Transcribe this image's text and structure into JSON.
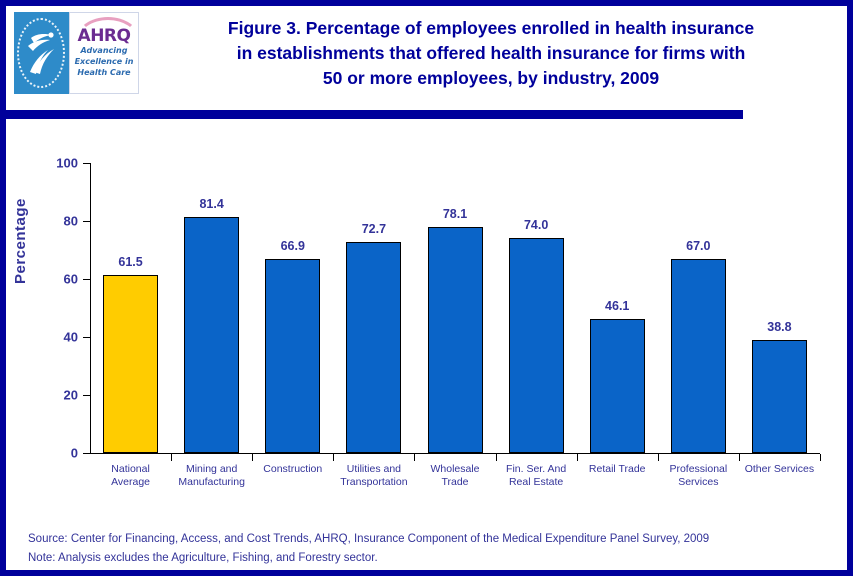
{
  "header": {
    "title": "Figure 3. Percentage of employees enrolled in health insurance in establishments that offered health insurance for firms with 50 or more employees, by industry, 2009",
    "title_line1": "Figure 3. Percentage of employees enrolled in health insurance",
    "title_line2": "in establishments that offered health insurance for firms with",
    "title_line3": "50 or more employees, by industry, 2009",
    "logo": {
      "seal_name": "hhs-department-seal",
      "agency_acronym": "AHRQ",
      "tagline_line1": "Advancing",
      "tagline_line2": "Excellence in",
      "tagline_line3": "Health Care"
    }
  },
  "footnotes": {
    "source": "Source: Center for Financing, Access, and Cost Trends, AHRQ, Insurance Component of the Medical Expenditure Panel Survey, 2009",
    "note": "Note: Analysis excludes the Agriculture, Fishing, and Forestry sector."
  },
  "colors": {
    "frame": "#00009B",
    "title": "#00009B",
    "rule": "#00009B",
    "bar_default": "#0A64C8",
    "bar_highlight": "#FFCC00",
    "bar_outline": "#000000",
    "label_text": "#333399",
    "footnote_text": "#333399"
  },
  "chart_data": {
    "type": "bar",
    "title": "Figure 3. Percentage of employees enrolled in health insurance in establishments that offered health insurance for firms with 50 or more employees, by industry, 2009",
    "xlabel": "",
    "ylabel": "Percentage",
    "ylim": [
      0,
      100
    ],
    "yticks": [
      0,
      20,
      40,
      60,
      80,
      100
    ],
    "ytick_labels": [
      "0",
      "20",
      "40",
      "60",
      "80",
      "100"
    ],
    "grid": false,
    "legend": null,
    "categories": [
      "National Average",
      "Mining and Manufacturing",
      "Construction",
      "Utilities and Transportation",
      "Wholesale Trade",
      "Fin. Ser. And Real Estate",
      "Retail Trade",
      "Professional Services",
      "Other Services"
    ],
    "category_lines": [
      [
        "National",
        "Average"
      ],
      [
        "Mining and",
        "Manufacturing"
      ],
      [
        "Construction",
        ""
      ],
      [
        "Utilities and",
        "Transportation"
      ],
      [
        "Wholesale",
        "Trade"
      ],
      [
        "Fin. Ser. And",
        "Real Estate"
      ],
      [
        "Retail Trade",
        ""
      ],
      [
        "Professional",
        "Services"
      ],
      [
        "Other Services",
        ""
      ]
    ],
    "values": [
      61.5,
      81.4,
      66.9,
      72.7,
      78.1,
      74.0,
      46.1,
      67.0,
      38.8
    ],
    "value_labels": [
      "61.5",
      "81.4",
      "66.9",
      "72.7",
      "78.1",
      "74.0",
      "46.1",
      "67.0",
      "38.8"
    ],
    "bar_colors": [
      "#FFCC00",
      "#0A64C8",
      "#0A64C8",
      "#0A64C8",
      "#0A64C8",
      "#0A64C8",
      "#0A64C8",
      "#0A64C8",
      "#0A64C8"
    ]
  }
}
